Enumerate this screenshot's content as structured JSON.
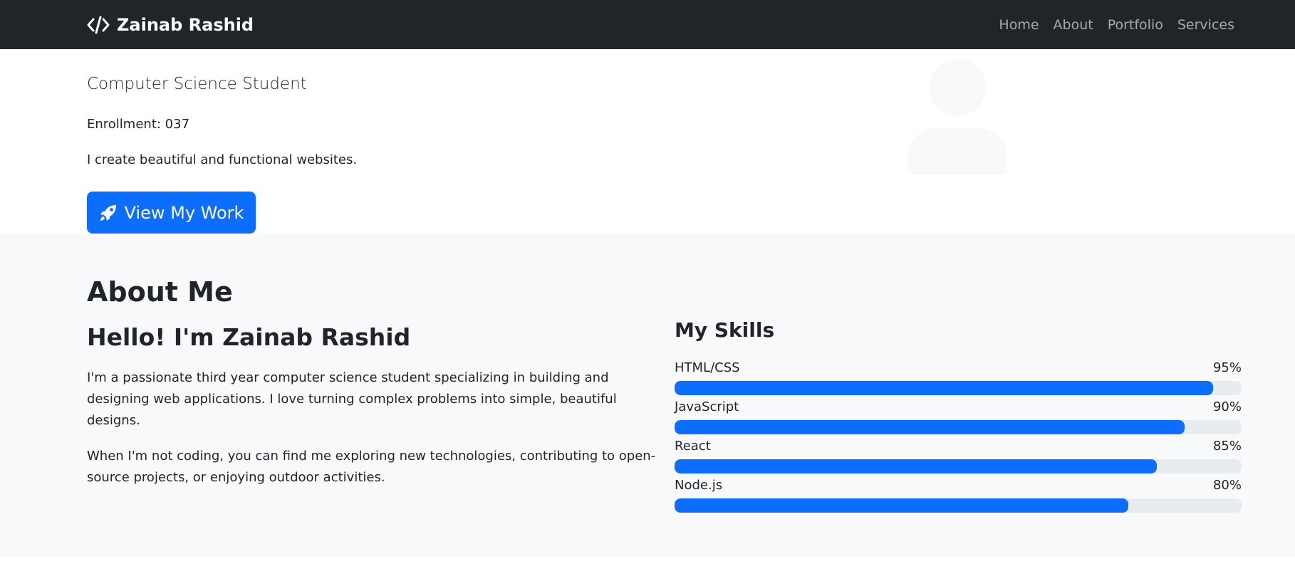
{
  "navbar": {
    "brand": "Zainab Rashid",
    "brand_icon": "code-icon",
    "links": [
      "Home",
      "About",
      "Portfolio",
      "Services"
    ]
  },
  "hero": {
    "subtitle": "Computer Science Student",
    "enrollment": "Enrollment: 037",
    "tagline": "I create beautiful and functional websites.",
    "button_label": "View My Work",
    "button_icon": "rocket-icon",
    "avatar_icon": "person-icon"
  },
  "about": {
    "heading": "About Me",
    "hello": "Hello! I'm Zainab Rashid",
    "paragraph1": "I'm a passionate third year computer science student specializing in building and designing web applications. I love turning complex problems into simple, beautiful designs.",
    "paragraph2": "When I'm not coding, you can find me exploring new technologies, contributing to open-source projects, or enjoying outdoor activities."
  },
  "skills": {
    "title": "My Skills",
    "items": [
      {
        "name": "HTML/CSS",
        "percent_label": "95%",
        "value": 95
      },
      {
        "name": "JavaScript",
        "percent_label": "90%",
        "value": 90
      },
      {
        "name": "React",
        "percent_label": "85%",
        "value": 85
      },
      {
        "name": "Node.js",
        "percent_label": "80%",
        "value": 80
      }
    ]
  },
  "colors": {
    "navbar_bg": "#212529",
    "primary": "#0d6efd",
    "section_bg": "#f8f9fa",
    "progress_track": "#e9ecef"
  }
}
